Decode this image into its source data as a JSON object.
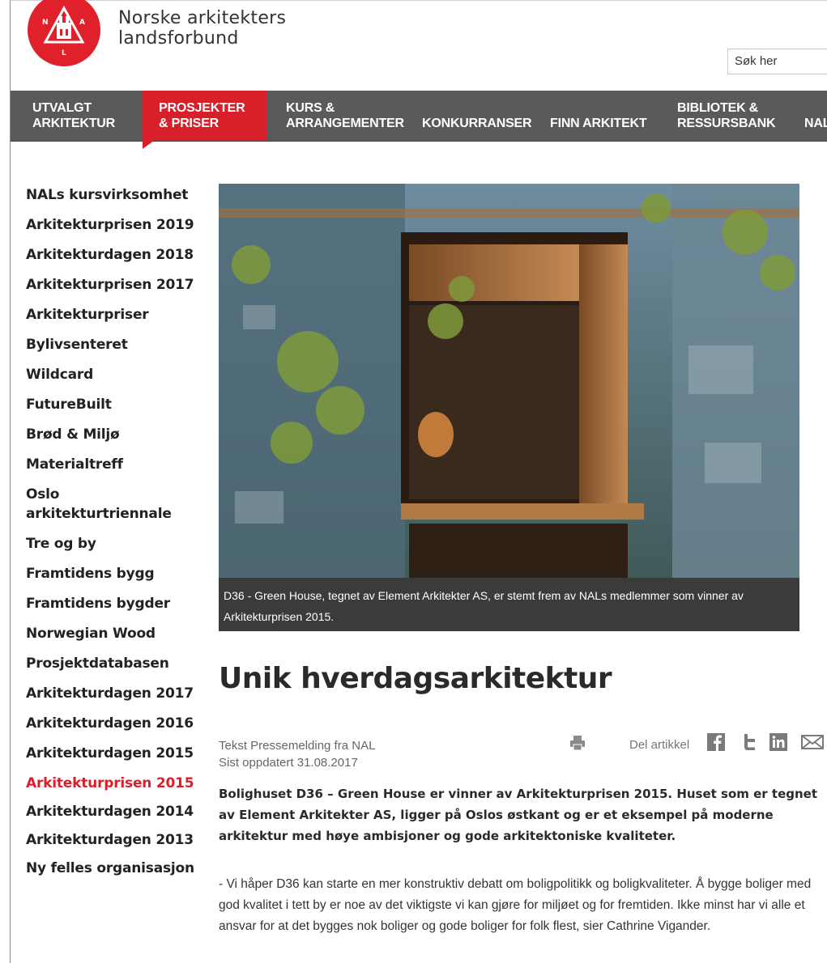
{
  "header": {
    "org_line1": "Norske arkitekters",
    "org_line2": "landsforbund",
    "logo_letters": {
      "left": "N",
      "right": "A",
      "bottom": "L"
    },
    "search_placeholder": "Søk her"
  },
  "nav": {
    "items": [
      {
        "label": "UTVALGT\nARKITEKTUR"
      },
      {
        "label": "PROSJEKTER\n& PRISER",
        "active": true
      },
      {
        "label": "KURS &\nARRANGEMENTER"
      },
      {
        "label": "KONKURRANSER"
      },
      {
        "label": "FINN ARKITEKT"
      },
      {
        "label": "BIBLIOTEK &\nRESSURSBANK"
      },
      {
        "label": "NAL"
      }
    ]
  },
  "sidebar": {
    "items": [
      "NALs kursvirksomhet",
      "Arkitekturprisen 2019",
      "Arkitekturdagen 2018",
      "Arkitekturprisen 2017",
      "Arkitekturpriser",
      "Bylivsenteret",
      "Wildcard",
      "FutureBuilt",
      "Brød & Miljø",
      "Materialtreff",
      "Oslo\narkitekturtriennale",
      "Tre og by",
      "Framtidens bygg",
      "Framtidens bygder",
      "Norwegian Wood",
      "Prosjektdatabasen",
      "Arkitekturdagen 2017",
      "Arkitekturdagen 2016",
      "Arkitekturdagen 2015",
      "Arkitekturprisen 2015",
      "Arkitekturdagen 2014",
      "Arkitekturdagen 2013",
      "Ny felles organisasjon"
    ],
    "active": "Arkitekturprisen 2015"
  },
  "article": {
    "image_caption": "D36 - Green House, tegnet av Element Arkitekter AS, er stemt frem av NALs medlemmer som vinner av Arkitekturprisen 2015.",
    "title": "Unik hverdagsarkitektur",
    "author": "Tekst Pressemelding fra NAL",
    "updated": "Sist oppdatert 31.08.2017",
    "share_label": "Del artikkel",
    "share_icons": [
      "facebook-icon",
      "twitter-icon",
      "linkedin-icon",
      "email-icon"
    ],
    "lead": "Bolighuset D36 – Green House er vinner av Arkitekturprisen 2015. Huset som er tegnet av Element Arkitekter AS, ligger på Oslos østkant og er et eksempel på moderne arkitektur med høye ambisjoner og gode arkitektoniske kvaliteter.",
    "body": "- Vi håper D36 kan starte en mer konstruktiv debatt om boligpolitikk og boligkvaliteter. Å bygge boliger med god kvalitet i tett by er noe av det viktigste vi kan gjøre for miljøet og for fremtiden. Ikke minst har vi alle et ansvar for at det bygges nok boliger og gode boliger for folk flest, sier Cathrine Vigander."
  },
  "colors": {
    "brand_red": "#d8202b",
    "nav_bg": "#5a5a5a",
    "caption_bg": "#3b3b3b"
  }
}
